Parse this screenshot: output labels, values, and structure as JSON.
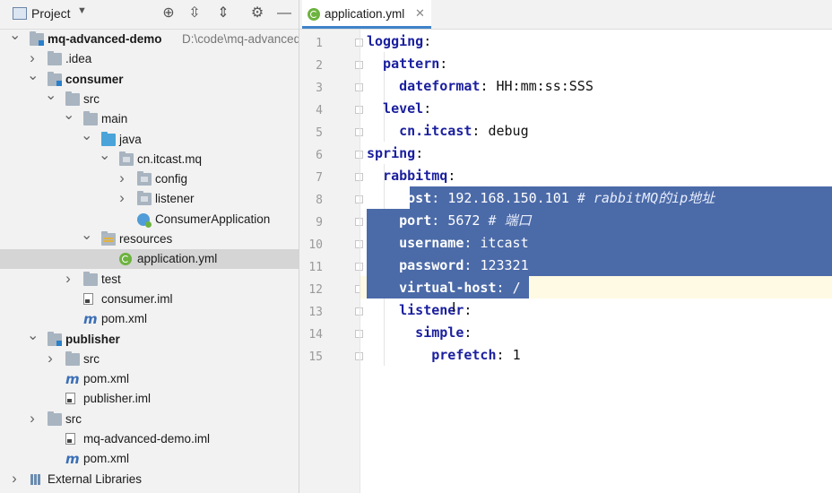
{
  "project_panel": {
    "title": "Project",
    "tree": [
      {
        "label": "mq-advanced-demo",
        "path": "D:\\code\\mq-advanced-de",
        "icon": "module-folder-icon",
        "depth": 0,
        "arrow": "down",
        "bold": true
      },
      {
        "label": ".idea",
        "icon": "folder-icon",
        "depth": 1,
        "arrow": "right"
      },
      {
        "label": "consumer",
        "icon": "module-folder-icon",
        "depth": 1,
        "arrow": "down",
        "bold": true
      },
      {
        "label": "src",
        "icon": "folder-icon",
        "depth": 2,
        "arrow": "down"
      },
      {
        "label": "main",
        "icon": "folder-icon",
        "depth": 3,
        "arrow": "down"
      },
      {
        "label": "java",
        "icon": "java-folder-icon",
        "depth": 4,
        "arrow": "down"
      },
      {
        "label": "cn.itcast.mq",
        "icon": "package-icon",
        "depth": 5,
        "arrow": "down"
      },
      {
        "label": "config",
        "icon": "package-icon",
        "depth": 6,
        "arrow": "right"
      },
      {
        "label": "listener",
        "icon": "package-icon",
        "depth": 6,
        "arrow": "right"
      },
      {
        "label": "ConsumerApplication",
        "icon": "spring-class-icon",
        "depth": 6,
        "arrow": "none"
      },
      {
        "label": "resources",
        "icon": "resources-folder-icon",
        "depth": 4,
        "arrow": "down"
      },
      {
        "label": "application.yml",
        "icon": "spring-yml-icon",
        "depth": 5,
        "arrow": "none",
        "selected": true
      },
      {
        "label": "test",
        "icon": "folder-icon",
        "depth": 3,
        "arrow": "right"
      },
      {
        "label": "consumer.iml",
        "icon": "iml-file-icon",
        "depth": 3,
        "arrow": "none"
      },
      {
        "label": "pom.xml",
        "icon": "maven-icon",
        "depth": 3,
        "arrow": "none"
      },
      {
        "label": "publisher",
        "icon": "module-folder-icon",
        "depth": 1,
        "arrow": "down",
        "bold": true
      },
      {
        "label": "src",
        "icon": "folder-icon",
        "depth": 2,
        "arrow": "right"
      },
      {
        "label": "pom.xml",
        "icon": "maven-icon",
        "depth": 2,
        "arrow": "none"
      },
      {
        "label": "publisher.iml",
        "icon": "iml-file-icon",
        "depth": 2,
        "arrow": "none"
      },
      {
        "label": "src",
        "icon": "folder-icon",
        "depth": 1,
        "arrow": "right"
      },
      {
        "label": "mq-advanced-demo.iml",
        "icon": "iml-file-icon",
        "depth": 2,
        "arrow": "none"
      },
      {
        "label": "pom.xml",
        "icon": "maven-icon",
        "depth": 2,
        "arrow": "none"
      },
      {
        "label": "External Libraries",
        "icon": "library-icon",
        "depth": 0,
        "arrow": "right"
      }
    ]
  },
  "editor": {
    "tab_label": "application.yml",
    "lines": [
      {
        "n": "1",
        "indent": 0,
        "key": "logging",
        "value": "",
        "comment": ""
      },
      {
        "n": "2",
        "indent": 1,
        "key": "pattern",
        "value": "",
        "comment": ""
      },
      {
        "n": "3",
        "indent": 2,
        "key": "dateformat",
        "value": "HH:mm:ss:SSS",
        "comment": ""
      },
      {
        "n": "4",
        "indent": 1,
        "key": "level",
        "value": "",
        "comment": ""
      },
      {
        "n": "5",
        "indent": 2,
        "key": "cn.itcast",
        "value": "debug",
        "comment": ""
      },
      {
        "n": "6",
        "indent": 0,
        "key": "spring",
        "value": "",
        "comment": ""
      },
      {
        "n": "7",
        "indent": 1,
        "key": "rabbitmq",
        "value": "",
        "comment": ""
      },
      {
        "n": "8",
        "indent": 2,
        "key": "host",
        "value": "192.168.150.101",
        "comment": "# rabbitMQ的ip地址"
      },
      {
        "n": "9",
        "indent": 2,
        "key": "port",
        "value": "5672",
        "comment": "# 端口"
      },
      {
        "n": "10",
        "indent": 2,
        "key": "username",
        "value": "itcast",
        "comment": ""
      },
      {
        "n": "11",
        "indent": 2,
        "key": "password",
        "value": "123321",
        "comment": ""
      },
      {
        "n": "12",
        "indent": 2,
        "key": "virtual-host",
        "value": "/",
        "comment": ""
      },
      {
        "n": "13",
        "indent": 2,
        "key": "listener",
        "value": "",
        "comment": ""
      },
      {
        "n": "14",
        "indent": 3,
        "key": "simple",
        "value": "",
        "comment": ""
      },
      {
        "n": "15",
        "indent": 4,
        "key": "prefetch",
        "value": "1",
        "comment": ""
      }
    ],
    "selected_lines": [
      "8",
      "9",
      "10",
      "11",
      "12"
    ],
    "current_line": "12"
  },
  "colors": {
    "keyword": "#1a1f9e",
    "selection": "#4b6aa8",
    "current_line": "#fffae3",
    "comment": "#7f7f7f"
  }
}
